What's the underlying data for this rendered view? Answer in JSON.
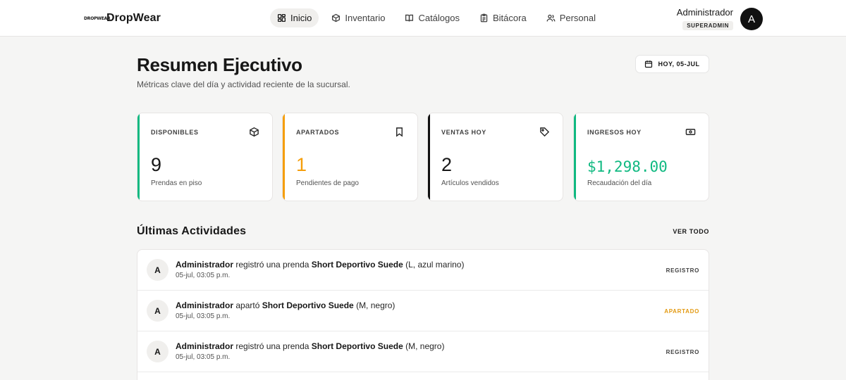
{
  "brand": {
    "mark": "DROPWEAR",
    "name": "DropWear"
  },
  "nav": [
    {
      "label": "Inicio",
      "icon": "dashboard-icon",
      "active": true
    },
    {
      "label": "Inventario",
      "icon": "box-icon"
    },
    {
      "label": "Catálogos",
      "icon": "book-icon"
    },
    {
      "label": "Bitácora",
      "icon": "clipboard-icon"
    },
    {
      "label": "Personal",
      "icon": "users-icon"
    }
  ],
  "user": {
    "name": "Administrador",
    "role": "SUPERADMIN",
    "initial": "A"
  },
  "header": {
    "title": "Resumen Ejecutivo",
    "subtitle": "Métricas clave del día y actividad reciente de la sucursal.",
    "date_chip": "HOY, 05-JUL"
  },
  "cards": [
    {
      "label": "DISPONIBLES",
      "value": "9",
      "desc": "Prendas en piso",
      "accent": "#10b981",
      "value_color": "#171717",
      "icon": "cube-icon"
    },
    {
      "label": "APARTADOS",
      "value": "1",
      "desc": "Pendientes de pago",
      "accent": "#f59e0b",
      "value_color": "#f59e0b",
      "icon": "bookmark-icon"
    },
    {
      "label": "VENTAS HOY",
      "value": "2",
      "desc": "Artículos vendidos",
      "accent": "#111111",
      "value_color": "#171717",
      "icon": "tag-icon"
    },
    {
      "label": "INGRESOS HOY",
      "value": "$1,298.00",
      "desc": "Recaudación del día",
      "accent": "#10b981",
      "value_color": "#10b981",
      "icon": "cash-icon"
    }
  ],
  "activities_section": {
    "title": "Últimas Actividades",
    "see_all": "VER TODO"
  },
  "activities": [
    {
      "initial": "A",
      "actor": "Administrador",
      "verb": " registró una prenda ",
      "item": "Short Deportivo Suede",
      "detail": " (L, azul marino)",
      "time": "05-jul, 03:05 p.m.",
      "tag": "REGISTRO"
    },
    {
      "initial": "A",
      "actor": "Administrador",
      "verb": " apartó ",
      "item": "Short Deportivo Suede",
      "detail": " (M, negro)",
      "time": "05-jul, 03:05 p.m.",
      "tag": "APARTADO"
    },
    {
      "initial": "A",
      "actor": "Administrador",
      "verb": " registró una prenda ",
      "item": "Short Deportivo Suede",
      "detail": " (M, negro)",
      "time": "05-jul, 03:05 p.m.",
      "tag": "REGISTRO"
    }
  ]
}
